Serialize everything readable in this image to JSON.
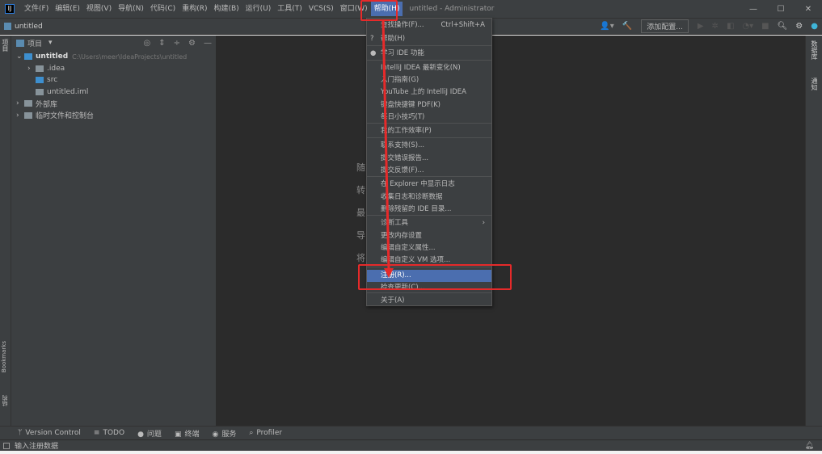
{
  "titlebar": {
    "menus": [
      "文件(F)",
      "编辑(E)",
      "视图(V)",
      "导航(N)",
      "代码(C)",
      "重构(R)",
      "构建(B)",
      "运行(U)",
      "工具(T)",
      "VCS(S)",
      "窗口(W)",
      "帮助(H)"
    ],
    "active_menu": "帮助(H)",
    "window_title": "untitled - Administrator",
    "minimize": "—",
    "maximize": "☐",
    "close": "✕"
  },
  "navbar": {
    "breadcrumb": "untitled",
    "run_config": "添加配置..."
  },
  "project": {
    "title": "项目",
    "tree": [
      {
        "label": "untitled",
        "path": "C:\\Users\\meer\\IdeaProjects\\untitled",
        "arrow": "⌄",
        "icon": "module-folder-icon",
        "indent": 0
      },
      {
        "label": ".idea",
        "arrow": "›",
        "icon": "folder-icon",
        "indent": 1
      },
      {
        "label": "src",
        "arrow": "",
        "icon": "source-folder-icon",
        "indent": 1
      },
      {
        "label": "untitled.iml",
        "arrow": "",
        "icon": "iml-file-icon",
        "indent": 1
      },
      {
        "label": "外部库",
        "arrow": "›",
        "icon": "library-icon",
        "indent": 0
      },
      {
        "label": "临时文件和控制台",
        "arrow": "›",
        "icon": "scratch-icon",
        "indent": 0
      }
    ]
  },
  "left_stripe": {
    "top": "项目",
    "bottom1": "Bookmarks",
    "bottom2": "结构"
  },
  "right_stripe": {
    "item1": "数据库",
    "item2": "通知"
  },
  "editor": {
    "hints": [
      "随",
      "转",
      "最",
      "导",
      "将"
    ]
  },
  "help_menu": {
    "items": [
      {
        "label": "查找操作(F)...",
        "shortcut": "Ctrl+Shift+A"
      },
      {
        "label": "帮助(H)",
        "prefix": "?"
      },
      {
        "label": "学习 IDE 功能",
        "prefix": "●"
      },
      {
        "label": "IntelliJ IDEA 最新变化(N)"
      },
      {
        "label": "入门指南(G)"
      },
      {
        "label": "YouTube 上的 IntelliJ IDEA"
      },
      {
        "label": "键盘快捷键 PDF(K)"
      },
      {
        "label": "每日小技巧(T)"
      },
      {
        "label": "我的工作效率(P)"
      },
      {
        "label": "联系支持(S)..."
      },
      {
        "label": "提交错误报告..."
      },
      {
        "label": "提交反馈(F)..."
      },
      {
        "label": "在 Explorer 中显示日志"
      },
      {
        "label": "收集日志和诊断数据"
      },
      {
        "label": "删除残留的 IDE 目录..."
      },
      {
        "label": "诊断工具",
        "submenu": "›"
      },
      {
        "label": "更改内存设置"
      },
      {
        "label": "编辑自定义属性..."
      },
      {
        "label": "编辑自定义 VM 选项..."
      },
      {
        "label": "注册(R)...",
        "selected": true
      },
      {
        "label": "检查更新(C)..."
      },
      {
        "label": "关于(A)"
      }
    ]
  },
  "bottombar": {
    "items": [
      {
        "icon": "branch-icon",
        "glyph": "ᛘ",
        "label": "Version Control"
      },
      {
        "icon": "todo-icon",
        "glyph": "≡",
        "label": "TODO"
      },
      {
        "icon": "problems-icon",
        "glyph": "●",
        "label": "问题"
      },
      {
        "icon": "terminal-icon",
        "glyph": "▣",
        "label": "终端"
      },
      {
        "icon": "services-icon",
        "glyph": "◉",
        "label": "服务"
      },
      {
        "icon": "profiler-icon",
        "glyph": "⌕",
        "label": "Profiler"
      }
    ]
  },
  "statusbar": {
    "text": "输入注册数据"
  },
  "colors": {
    "accent": "#4b6eaf",
    "annotation": "#e62a2a",
    "panel": "#3c3f41",
    "editor": "#2b2b2b"
  }
}
